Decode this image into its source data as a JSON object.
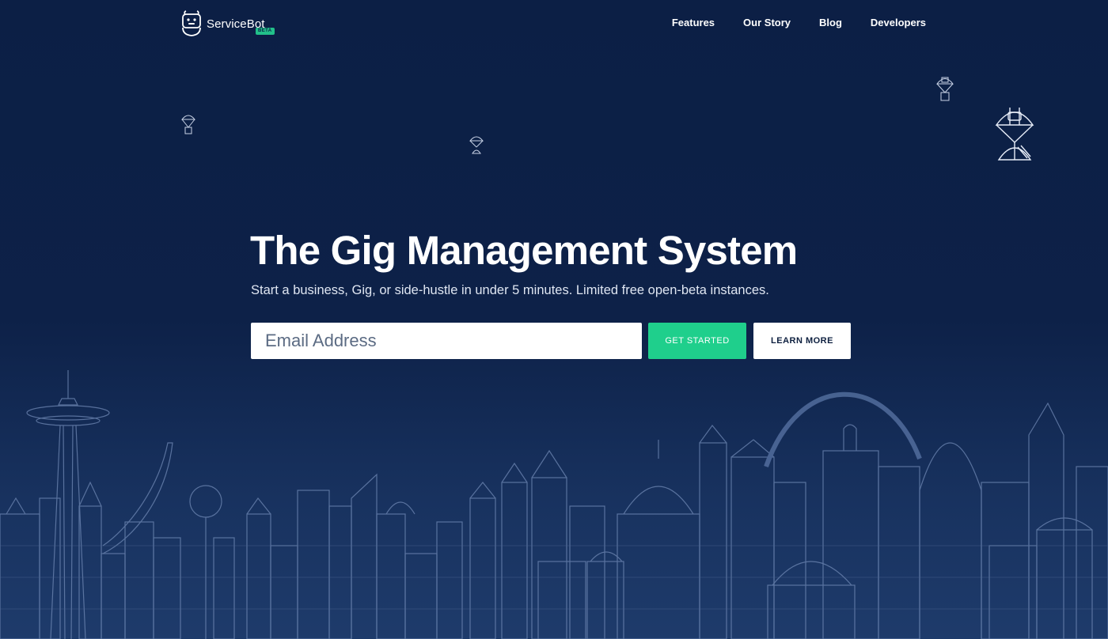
{
  "colors": {
    "background": "#0b1f45",
    "accent": "#1fcf8c",
    "button_secondary_bg": "#ffffff",
    "skyline_stroke": "#6f88b4"
  },
  "nav": {
    "logo": {
      "name": "ServiceBot",
      "badge": "BETA",
      "icon": "robot-icon"
    },
    "links": [
      {
        "label": "Features"
      },
      {
        "label": "Our Story"
      },
      {
        "label": "Blog"
      },
      {
        "label": "Developers"
      }
    ]
  },
  "decor": {
    "parachute_icon": "parachute-robot-icon",
    "skyline": "city-skyline-illustration"
  },
  "hero": {
    "title": "The Gig Management System",
    "subtitle": "Start a business, Gig, or side-hustle in under 5 minutes. Limited free open-beta instances.",
    "email_placeholder": "Email Address",
    "email_value": "",
    "primary_button": "GET STARTED",
    "secondary_button": "LEARN MORE"
  }
}
